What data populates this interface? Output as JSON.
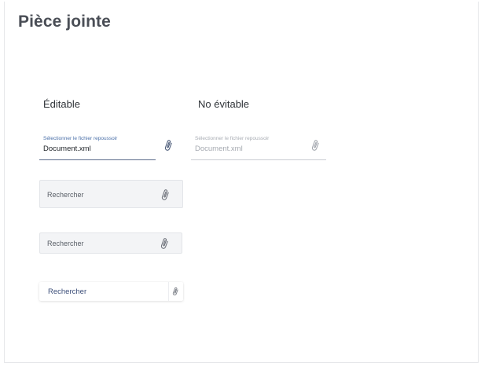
{
  "page": {
    "title": "Pièce jointe"
  },
  "columns": {
    "editable_label": "Éditable",
    "disabled_label": "No évitable"
  },
  "editable_field": {
    "label": "Sélectionner le fichier repoussoir",
    "value": "Document.xml",
    "icon": "paperclip-icon"
  },
  "disabled_field": {
    "label": "Sélectionner le fichier repoussoir",
    "value": "Document.xml",
    "icon": "paperclip-icon"
  },
  "search_fields": [
    {
      "placeholder": "Rechercher",
      "icon": "paperclip-icon"
    },
    {
      "placeholder": "Rechercher",
      "icon": "paperclip-icon"
    },
    {
      "placeholder": "Rechercher",
      "icon": "paperclip-icon"
    }
  ],
  "colors": {
    "title": "#4a4e56",
    "accent_label": "#4a6fa8",
    "underline": "#5b6b8a",
    "search_bg": "#f3f4f6"
  }
}
